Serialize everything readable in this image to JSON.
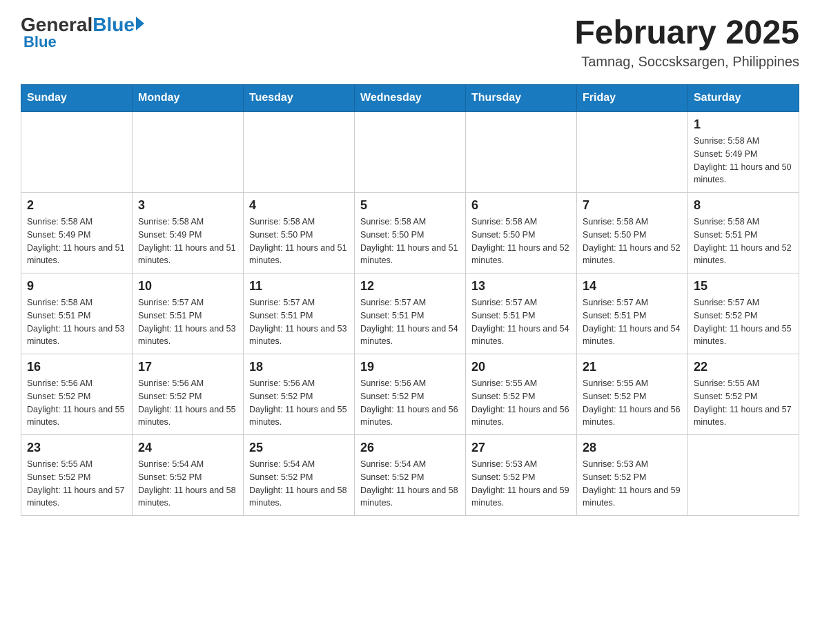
{
  "header": {
    "logo_general": "General",
    "logo_blue": "Blue",
    "title": "February 2025",
    "subtitle": "Tamnag, Soccsksargen, Philippines"
  },
  "days_of_week": [
    "Sunday",
    "Monday",
    "Tuesday",
    "Wednesday",
    "Thursday",
    "Friday",
    "Saturday"
  ],
  "weeks": [
    {
      "days": [
        {
          "num": "",
          "sunrise": "",
          "sunset": "",
          "daylight": ""
        },
        {
          "num": "",
          "sunrise": "",
          "sunset": "",
          "daylight": ""
        },
        {
          "num": "",
          "sunrise": "",
          "sunset": "",
          "daylight": ""
        },
        {
          "num": "",
          "sunrise": "",
          "sunset": "",
          "daylight": ""
        },
        {
          "num": "",
          "sunrise": "",
          "sunset": "",
          "daylight": ""
        },
        {
          "num": "",
          "sunrise": "",
          "sunset": "",
          "daylight": ""
        },
        {
          "num": "1",
          "sunrise": "Sunrise: 5:58 AM",
          "sunset": "Sunset: 5:49 PM",
          "daylight": "Daylight: 11 hours and 50 minutes."
        }
      ]
    },
    {
      "days": [
        {
          "num": "2",
          "sunrise": "Sunrise: 5:58 AM",
          "sunset": "Sunset: 5:49 PM",
          "daylight": "Daylight: 11 hours and 51 minutes."
        },
        {
          "num": "3",
          "sunrise": "Sunrise: 5:58 AM",
          "sunset": "Sunset: 5:49 PM",
          "daylight": "Daylight: 11 hours and 51 minutes."
        },
        {
          "num": "4",
          "sunrise": "Sunrise: 5:58 AM",
          "sunset": "Sunset: 5:50 PM",
          "daylight": "Daylight: 11 hours and 51 minutes."
        },
        {
          "num": "5",
          "sunrise": "Sunrise: 5:58 AM",
          "sunset": "Sunset: 5:50 PM",
          "daylight": "Daylight: 11 hours and 51 minutes."
        },
        {
          "num": "6",
          "sunrise": "Sunrise: 5:58 AM",
          "sunset": "Sunset: 5:50 PM",
          "daylight": "Daylight: 11 hours and 52 minutes."
        },
        {
          "num": "7",
          "sunrise": "Sunrise: 5:58 AM",
          "sunset": "Sunset: 5:50 PM",
          "daylight": "Daylight: 11 hours and 52 minutes."
        },
        {
          "num": "8",
          "sunrise": "Sunrise: 5:58 AM",
          "sunset": "Sunset: 5:51 PM",
          "daylight": "Daylight: 11 hours and 52 minutes."
        }
      ]
    },
    {
      "days": [
        {
          "num": "9",
          "sunrise": "Sunrise: 5:58 AM",
          "sunset": "Sunset: 5:51 PM",
          "daylight": "Daylight: 11 hours and 53 minutes."
        },
        {
          "num": "10",
          "sunrise": "Sunrise: 5:57 AM",
          "sunset": "Sunset: 5:51 PM",
          "daylight": "Daylight: 11 hours and 53 minutes."
        },
        {
          "num": "11",
          "sunrise": "Sunrise: 5:57 AM",
          "sunset": "Sunset: 5:51 PM",
          "daylight": "Daylight: 11 hours and 53 minutes."
        },
        {
          "num": "12",
          "sunrise": "Sunrise: 5:57 AM",
          "sunset": "Sunset: 5:51 PM",
          "daylight": "Daylight: 11 hours and 54 minutes."
        },
        {
          "num": "13",
          "sunrise": "Sunrise: 5:57 AM",
          "sunset": "Sunset: 5:51 PM",
          "daylight": "Daylight: 11 hours and 54 minutes."
        },
        {
          "num": "14",
          "sunrise": "Sunrise: 5:57 AM",
          "sunset": "Sunset: 5:51 PM",
          "daylight": "Daylight: 11 hours and 54 minutes."
        },
        {
          "num": "15",
          "sunrise": "Sunrise: 5:57 AM",
          "sunset": "Sunset: 5:52 PM",
          "daylight": "Daylight: 11 hours and 55 minutes."
        }
      ]
    },
    {
      "days": [
        {
          "num": "16",
          "sunrise": "Sunrise: 5:56 AM",
          "sunset": "Sunset: 5:52 PM",
          "daylight": "Daylight: 11 hours and 55 minutes."
        },
        {
          "num": "17",
          "sunrise": "Sunrise: 5:56 AM",
          "sunset": "Sunset: 5:52 PM",
          "daylight": "Daylight: 11 hours and 55 minutes."
        },
        {
          "num": "18",
          "sunrise": "Sunrise: 5:56 AM",
          "sunset": "Sunset: 5:52 PM",
          "daylight": "Daylight: 11 hours and 55 minutes."
        },
        {
          "num": "19",
          "sunrise": "Sunrise: 5:56 AM",
          "sunset": "Sunset: 5:52 PM",
          "daylight": "Daylight: 11 hours and 56 minutes."
        },
        {
          "num": "20",
          "sunrise": "Sunrise: 5:55 AM",
          "sunset": "Sunset: 5:52 PM",
          "daylight": "Daylight: 11 hours and 56 minutes."
        },
        {
          "num": "21",
          "sunrise": "Sunrise: 5:55 AM",
          "sunset": "Sunset: 5:52 PM",
          "daylight": "Daylight: 11 hours and 56 minutes."
        },
        {
          "num": "22",
          "sunrise": "Sunrise: 5:55 AM",
          "sunset": "Sunset: 5:52 PM",
          "daylight": "Daylight: 11 hours and 57 minutes."
        }
      ]
    },
    {
      "days": [
        {
          "num": "23",
          "sunrise": "Sunrise: 5:55 AM",
          "sunset": "Sunset: 5:52 PM",
          "daylight": "Daylight: 11 hours and 57 minutes."
        },
        {
          "num": "24",
          "sunrise": "Sunrise: 5:54 AM",
          "sunset": "Sunset: 5:52 PM",
          "daylight": "Daylight: 11 hours and 58 minutes."
        },
        {
          "num": "25",
          "sunrise": "Sunrise: 5:54 AM",
          "sunset": "Sunset: 5:52 PM",
          "daylight": "Daylight: 11 hours and 58 minutes."
        },
        {
          "num": "26",
          "sunrise": "Sunrise: 5:54 AM",
          "sunset": "Sunset: 5:52 PM",
          "daylight": "Daylight: 11 hours and 58 minutes."
        },
        {
          "num": "27",
          "sunrise": "Sunrise: 5:53 AM",
          "sunset": "Sunset: 5:52 PM",
          "daylight": "Daylight: 11 hours and 59 minutes."
        },
        {
          "num": "28",
          "sunrise": "Sunrise: 5:53 AM",
          "sunset": "Sunset: 5:52 PM",
          "daylight": "Daylight: 11 hours and 59 minutes."
        },
        {
          "num": "",
          "sunrise": "",
          "sunset": "",
          "daylight": ""
        }
      ]
    }
  ]
}
